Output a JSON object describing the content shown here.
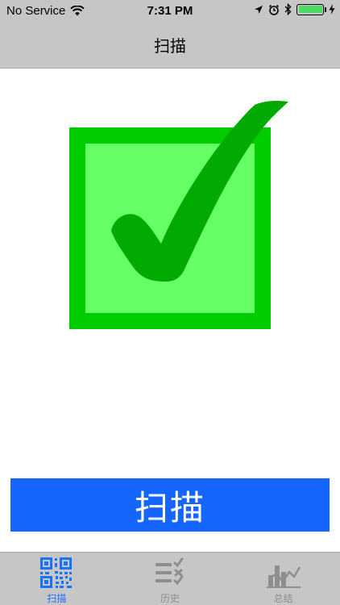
{
  "status_bar": {
    "carrier": "No Service",
    "time": "7:31 PM",
    "battery_color": "#4cd964"
  },
  "nav": {
    "title": "扫描"
  },
  "main": {
    "scan_button_label": "扫描",
    "scan_button_color": "#1566ff",
    "check_icon": "checkmark-box-icon"
  },
  "tabs": [
    {
      "label": "扫描",
      "icon": "qr-code-icon",
      "active": true
    },
    {
      "label": "历史",
      "icon": "history-list-icon",
      "active": false
    },
    {
      "label": "总结",
      "icon": "summary-chart-icon",
      "active": false
    }
  ],
  "colors": {
    "accent": "#1a73ff",
    "inactive": "#8e8e8e",
    "bar_bg": "#c6c6c6",
    "check_green": "#00aa00",
    "box_border": "#00cc00",
    "box_fill": "#66ff66"
  }
}
